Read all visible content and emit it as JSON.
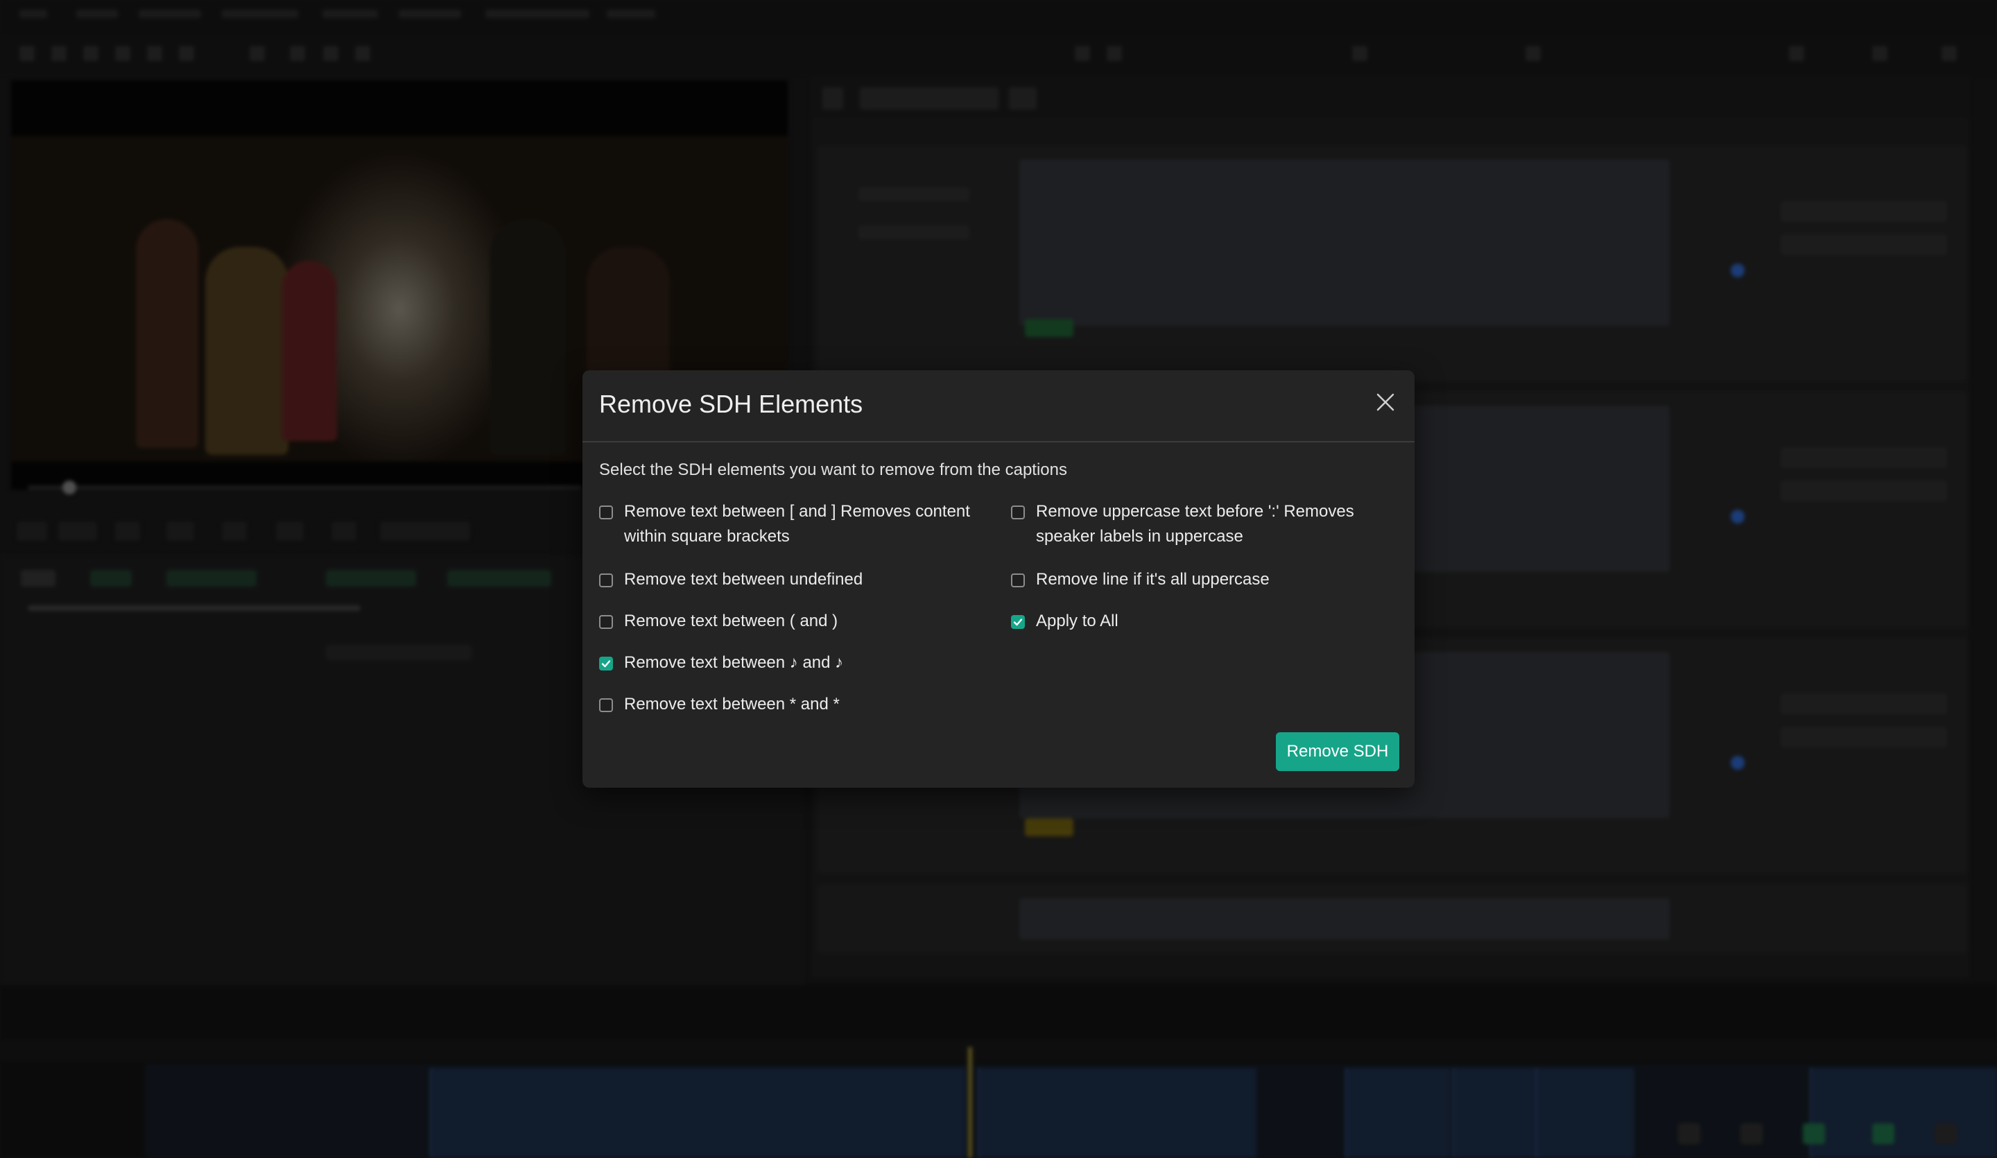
{
  "dialog": {
    "title": "Remove SDH Elements",
    "description": "Select the SDH elements you want to remove from the captions",
    "options_left": [
      {
        "label": "Remove text between [ and ] Removes content within square brackets",
        "checked": false
      },
      {
        "label": "Remove text between undefined",
        "checked": false
      },
      {
        "label": "Remove text between ( and )",
        "checked": false
      },
      {
        "label": "Remove text between ♪ and ♪",
        "checked": true
      },
      {
        "label": "Remove text between * and *",
        "checked": false
      }
    ],
    "options_right": [
      {
        "label": "Remove uppercase text before ':' Removes speaker labels in uppercase",
        "checked": false
      },
      {
        "label": "Remove line if it's all uppercase",
        "checked": false
      },
      {
        "label": "Apply to All",
        "checked": true
      }
    ],
    "primary_button": "Remove SDH",
    "close_icon": "close-icon",
    "accent_color": "#17a589"
  }
}
